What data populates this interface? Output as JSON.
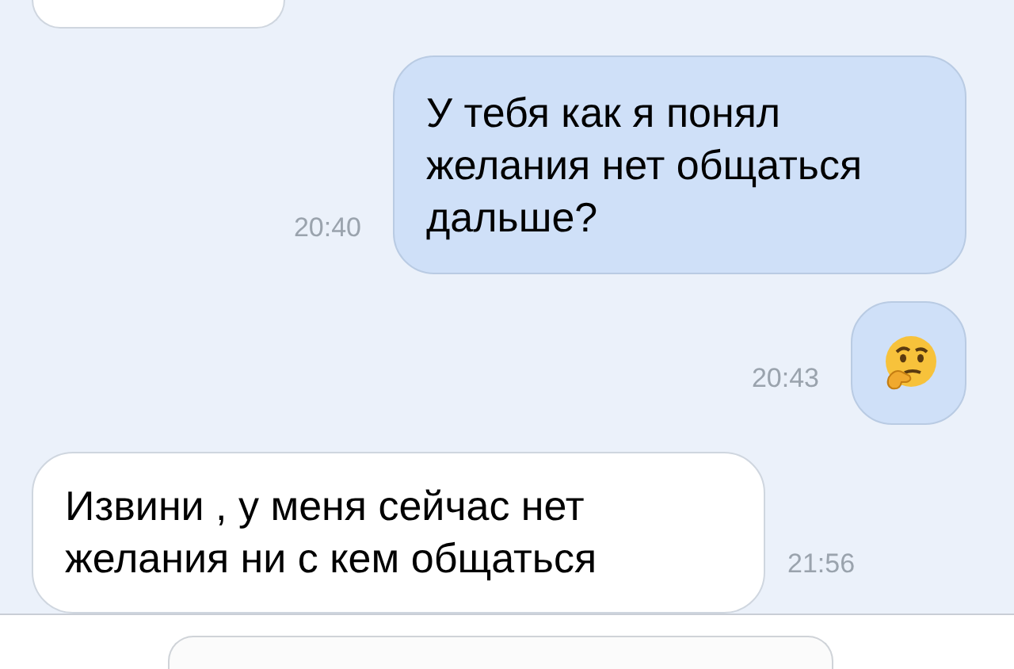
{
  "messages": [
    {
      "outgoing": false,
      "kind": "partial"
    },
    {
      "outgoing": true,
      "kind": "text",
      "text": "У тебя как я понял желания нет общаться дальше?",
      "time": "20:40"
    },
    {
      "outgoing": true,
      "kind": "emoji",
      "time": "20:43"
    },
    {
      "outgoing": false,
      "kind": "text",
      "text": "Извини , у меня сейчас нет желания ни с кем общаться",
      "time": "21:56"
    }
  ],
  "composer": {
    "kind": "field"
  }
}
